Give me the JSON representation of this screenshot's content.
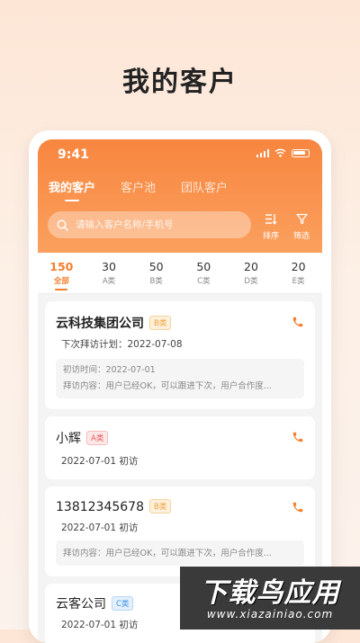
{
  "headline": "我的客户",
  "status_bar": {
    "time": "9:41"
  },
  "tabs": [
    {
      "label": "我的客户",
      "active": true
    },
    {
      "label": "客户池",
      "active": false
    },
    {
      "label": "团队客户",
      "active": false
    }
  ],
  "search": {
    "placeholder": "请输入客户名称/手机号",
    "value": ""
  },
  "toolbar": {
    "sort_label": "排序",
    "filter_label": "筛选"
  },
  "stats": [
    {
      "count": "150",
      "label": "全部",
      "active": true
    },
    {
      "count": "30",
      "label": "A类",
      "active": false
    },
    {
      "count": "50",
      "label": "B类",
      "active": false
    },
    {
      "count": "50",
      "label": "C类",
      "active": false
    },
    {
      "count": "20",
      "label": "D类",
      "active": false
    },
    {
      "count": "20",
      "label": "E类",
      "active": false
    }
  ],
  "customers": [
    {
      "name": "云科技集团公司",
      "category": "B类",
      "line2": "下次拜访计划：2022-07-08",
      "note_time": "初访时间：2022-07-01",
      "note_content": "拜访内容：用户已经OK，可以跟进下次，用户合作度..."
    },
    {
      "name": "小辉",
      "category": "A类",
      "line2": "2022-07-01 初访"
    },
    {
      "name": "13812345678",
      "category": "B类",
      "line2": "2022-07-01 初访",
      "note_content": "拜访内容：用户已经OK，可以跟进下次，用户合作度..."
    },
    {
      "name": "云客公司",
      "category": "C类",
      "line2": "2022-07-01 初访"
    }
  ],
  "watermark": {
    "text": "下载鸟应用",
    "url": "www.xiazainiao.com"
  },
  "colors": {
    "accent": "#f57f2d",
    "header_top": "#f7863f",
    "badge_a": "#e65a5a",
    "badge_b": "#f1a13a",
    "badge_c": "#3d93e8"
  }
}
